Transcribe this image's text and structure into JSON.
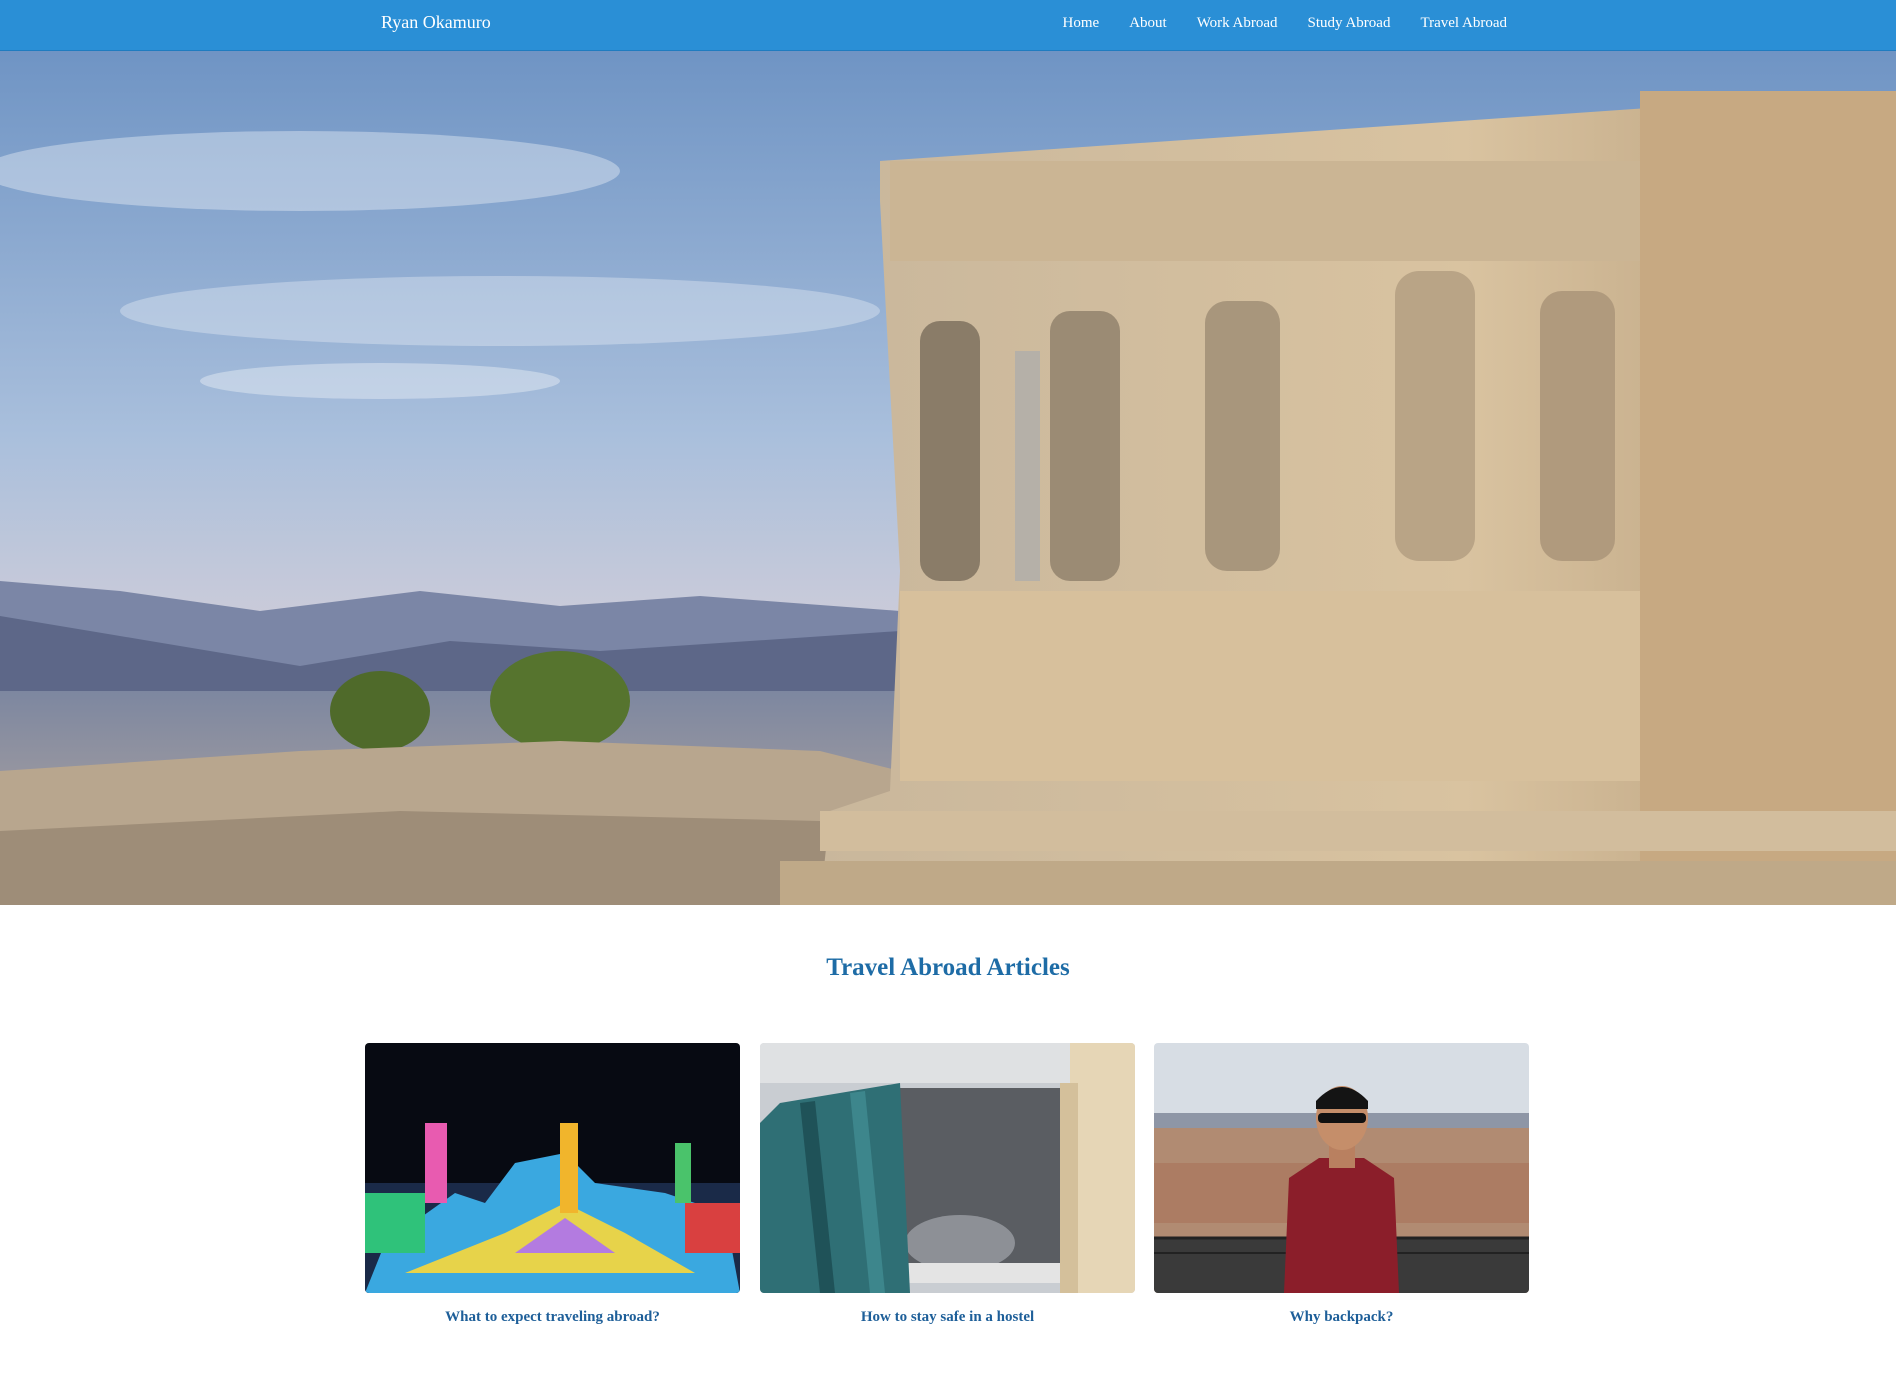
{
  "navbar": {
    "brand": "Ryan Okamuro",
    "links": [
      "Home",
      "About",
      "Work Abroad",
      "Study Abroad",
      "Travel Abroad"
    ],
    "background": "#2a8fd6"
  },
  "hero": {
    "image": "acropolis-caryatids-photo"
  },
  "articles_section": {
    "title": "Travel Abroad Articles",
    "title_color": "#1e6ca6",
    "articles": [
      {
        "caption": "What to expect traveling abroad?",
        "image": "ice-festival-photo"
      },
      {
        "caption": "How to stay safe in a hostel",
        "image": "hostel-bunk-photo"
      },
      {
        "caption": "Why backpack?",
        "image": "traveler-overlook-photo"
      }
    ]
  }
}
